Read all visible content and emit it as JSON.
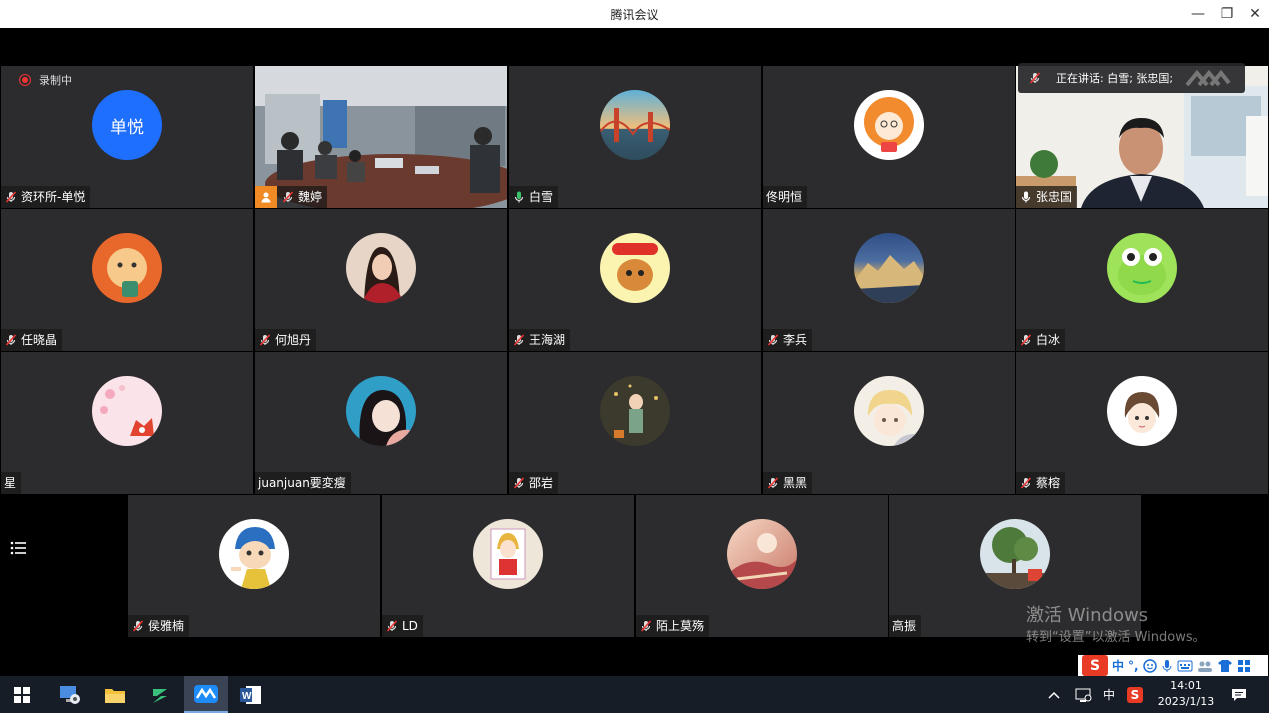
{
  "window": {
    "title": "腾讯会议",
    "minimize": "—",
    "restore": "❐",
    "close": "✕"
  },
  "recording": {
    "label": "录制中"
  },
  "speaking": {
    "label": "正在讲话: 白雪; 张忠国;"
  },
  "participants": [
    {
      "name": "资环所-单悦",
      "avatar_text": "单悦"
    },
    {
      "name": "魏婷"
    },
    {
      "name": "白雪"
    },
    {
      "name": "佟明恒"
    },
    {
      "name": "张忠国"
    },
    {
      "name": "任晓晶"
    },
    {
      "name": "何旭丹"
    },
    {
      "name": "王海湖"
    },
    {
      "name": "李兵"
    },
    {
      "name": "白冰"
    },
    {
      "name": "星"
    },
    {
      "name": "juanjuan要変瘦"
    },
    {
      "name": "邵岩"
    },
    {
      "name": "黑黑"
    },
    {
      "name": "蔡榕"
    },
    {
      "name": "侯雅楠"
    },
    {
      "name": "LD"
    },
    {
      "name": "陌上莫殇"
    },
    {
      "name": "高振"
    }
  ],
  "activation": {
    "line1": "激活 Windows",
    "line2": "转到“设置”以激活 Windows。"
  },
  "ime": {
    "mode": "中",
    "punct": "°,"
  },
  "tray": {
    "lang": "中"
  },
  "clock": {
    "time": "14:01",
    "date": "2023/1/13"
  },
  "colors": {
    "accent": "#1f6fff",
    "tile_bg": "#2c2c2e",
    "active_mic": "#3ac26b"
  }
}
